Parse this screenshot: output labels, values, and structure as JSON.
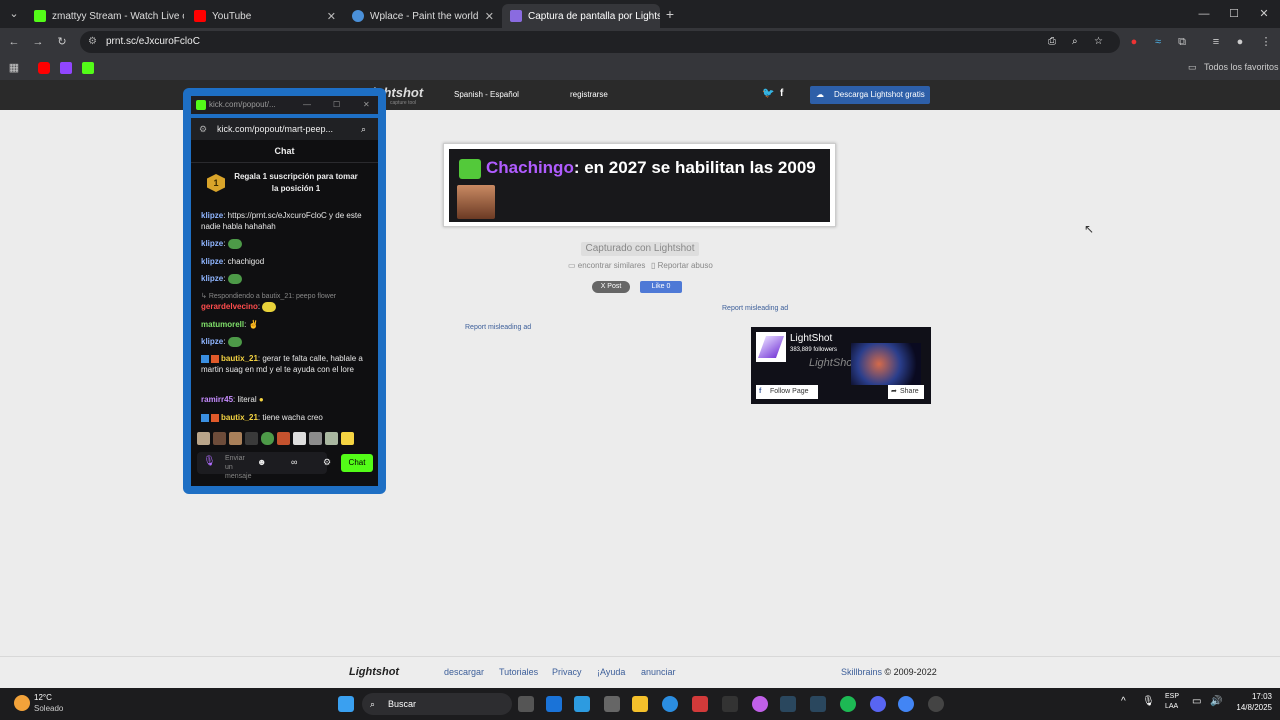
{
  "browser": {
    "tabs": [
      {
        "title": "zmattyy Stream - Watch Live o",
        "icon_color": "#53fc18",
        "active": false
      },
      {
        "title": "YouTube",
        "icon_color": "#ff0000",
        "active": false
      },
      {
        "title": "Wplace - Paint the world",
        "icon_color": "#4a90d9",
        "active": false
      },
      {
        "title": "Captura de pantalla por Lightsh",
        "icon_color": "#8a6be0",
        "active": true
      }
    ],
    "new_tab": "+",
    "url": "prnt.sc/eJxcuroFcloC",
    "all_bookmarks": "Todos los favoritos",
    "window_controls": {
      "minimize": "—",
      "maximize": "☐",
      "close": "✕"
    }
  },
  "lightshot_header": {
    "logo": "Lightshot",
    "logo_sub": "capture tool",
    "language": "Spanish - Español",
    "register": "registrarse",
    "download": "Descarga Lightshot gratis"
  },
  "screenshot": {
    "username": "Chachingo",
    "message": ": en 2027 se habilitan las 2009",
    "accent": "#b05cff"
  },
  "content": {
    "captured_with": "Capturado con Lightshot",
    "find_similar": "encontrar similares",
    "report_abuse": "Reportar abuso",
    "post_button": "X Post",
    "like_button": "Like 0",
    "report_ad_1": "Report misleading ad",
    "report_ad_2": "Report misleading ad"
  },
  "fb_widget": {
    "name": "LightShot",
    "followers": "383,889 followers",
    "follow": "Follow Page",
    "share": "Share",
    "watermark": "LightShot"
  },
  "kick_window": {
    "title": "kick.com/popout/...",
    "url": "kick.com/popout/mart-peep...",
    "chat_header": "Chat",
    "sub_gift": "Regala 1 suscripción para tomar la posición 1",
    "sub_rank": "1",
    "messages": [
      {
        "user": "klipze",
        "text": ": https://prnt.sc/eJxcuroFcloC y de este nadie habla hahahah"
      },
      {
        "user": "klipze",
        "text": ":"
      },
      {
        "user": "klipze",
        "text": ": chachigod"
      },
      {
        "user": "klipze",
        "text": ":"
      },
      {
        "user": "",
        "text": "Respondiendo a bautix_21: peepo flower"
      },
      {
        "user": "gerardelvecino",
        "text": ":"
      },
      {
        "user": "matumorell",
        "text": ":"
      },
      {
        "user": "klipze",
        "text": ":"
      },
      {
        "user": "bautix_21",
        "text": ": gerar te falta calle, hablale a martin suag en md y el te ayuda con el lore"
      },
      {
        "user": "ramirr45",
        "text": ": literal"
      },
      {
        "user": "bautix_21",
        "text": ": tiene wacha creo"
      }
    ],
    "input_placeholder": "Enviar un mensaje",
    "chat_button": "Chat"
  },
  "footer": {
    "logo": "Lightshot",
    "links": [
      "descargar",
      "Tutoriales",
      "Privacy",
      "¡Ayuda",
      "anunciar"
    ],
    "copyright_brand": "Skillbrains",
    "copyright": "© 2009-2022"
  },
  "taskbar": {
    "weather_temp": "12°C",
    "weather_desc": "Soleado",
    "search": "Buscar",
    "lang_1": "ESP",
    "lang_2": "LAA",
    "time": "17:03",
    "date": "14/8/2025"
  }
}
